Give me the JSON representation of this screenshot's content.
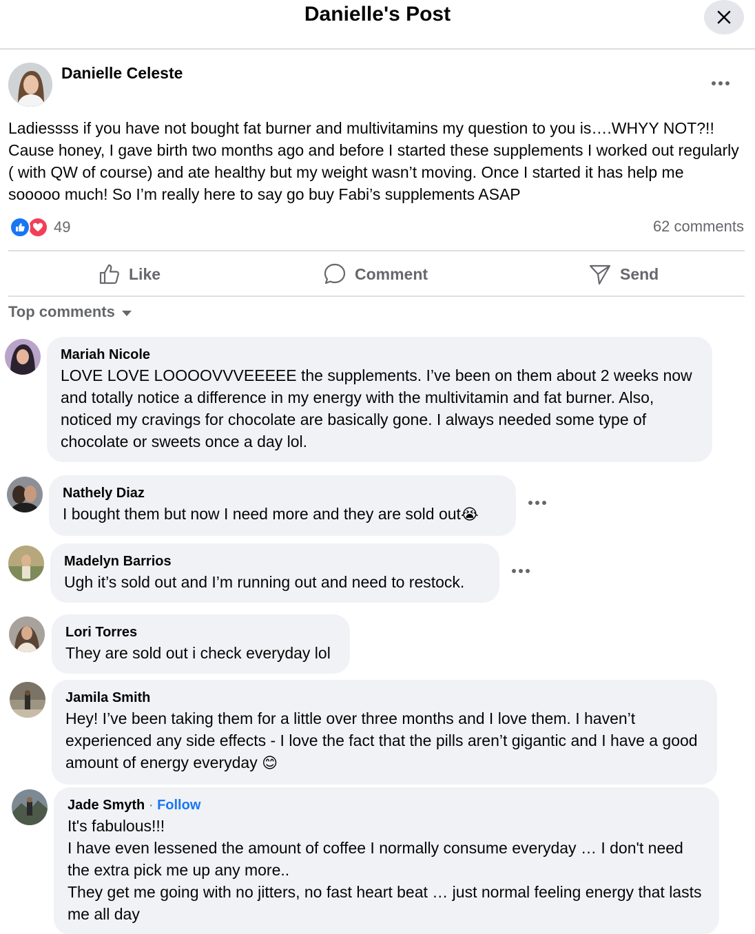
{
  "header": {
    "title": "Danielle's Post",
    "close_icon": "close-icon"
  },
  "post": {
    "author": "Danielle Celeste",
    "text": "Ladiessss if you have not bought fat burner and multivitamins my question to you is….WHYY NOT?!! Cause honey, I gave birth two months ago and before I started these supplements I worked out regularly ( with QW of course) and ate healthy but my weight wasn’t moving. Once I started it has help me sooooo much! So I’m really here to say go buy Fabi’s supplements ASAP",
    "reaction_count": "49",
    "comments_count": "62 comments",
    "reaction_icons": [
      "like-icon",
      "love-icon"
    ]
  },
  "actions": {
    "like": "Like",
    "comment": "Comment",
    "send": "Send"
  },
  "comments_header": "Top comments",
  "comments": [
    {
      "name": "Mariah Nicole",
      "text": "LOVE LOVE LOOOOVVVEEEEE the supplements. I’ve been on them about 2 weeks now and totally notice a difference in my energy with the multivitamin and fat burner. Also, noticed my cravings for chocolate are basically gone. I always needed some type of chocolate or sweets once a day lol."
    },
    {
      "name": "Nathely Diaz",
      "text": "I bought them but now I need more and they are sold out",
      "emoji": "😭"
    },
    {
      "name": "Madelyn Barrios",
      "text": "Ugh it’s sold out and I’m running out and need to restock."
    },
    {
      "name": "Lori Torres",
      "text": "They are sold out i check everyday lol"
    },
    {
      "name": "Jamila Smith",
      "text": "Hey! I’ve been taking them for a little over three months and I love them. I haven’t experienced any side effects - I love the fact that the pills aren’t gigantic and I have a good amount of energy everyday",
      "emoji": "😊"
    },
    {
      "name": "Jade Smyth",
      "separator": "·",
      "follow": "Follow",
      "lines": [
        "It's fabulous!!!",
        "I have even lessened the amount of coffee I normally consume everyday … I don't need the extra pick me up any more..",
        "They get me going with no jitters, no fast heart beat … just normal feeling energy that lasts me all day"
      ]
    }
  ],
  "colors": {
    "accent": "#1877f2",
    "love": "#f33e58",
    "bubble": "#f0f2f5",
    "muted": "#65676b"
  }
}
